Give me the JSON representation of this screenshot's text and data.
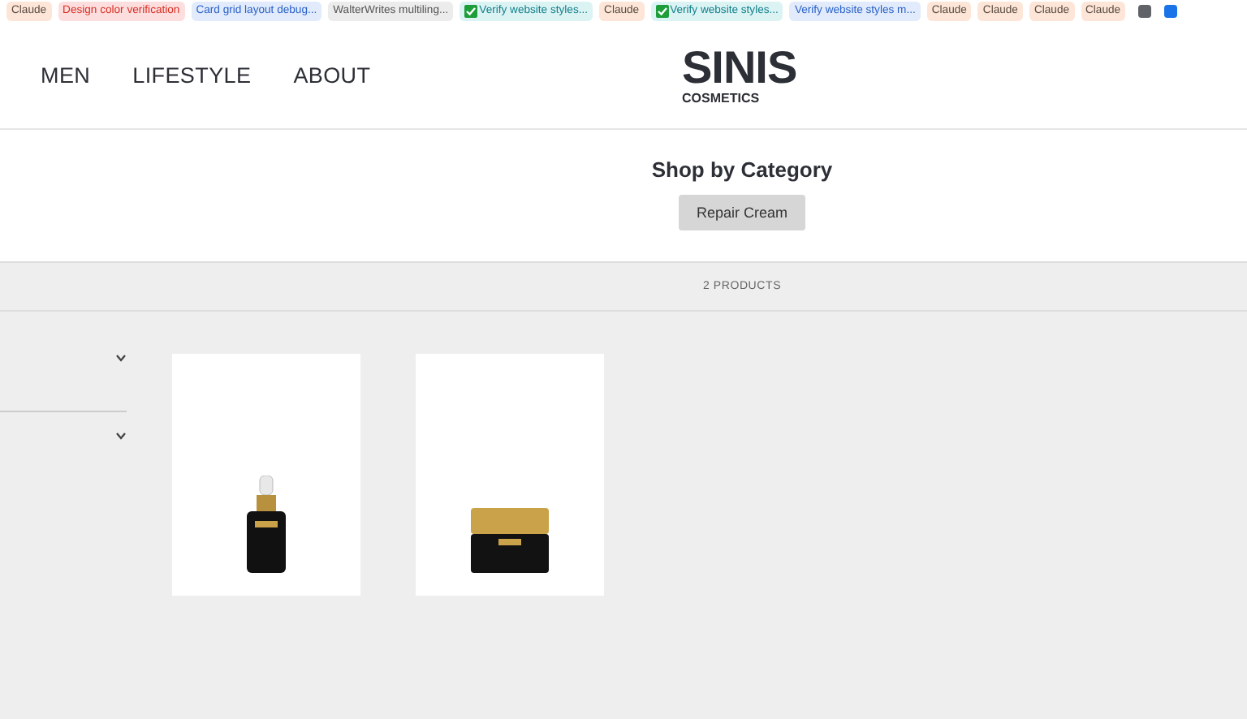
{
  "tab_groups": [
    {
      "kind": "chip",
      "label": "Claude",
      "color": "#fde6d8",
      "done": false
    },
    {
      "kind": "chip",
      "label": "Design color verification",
      "color": "#fddede",
      "done": false
    },
    {
      "kind": "chip",
      "label": "Card grid layout debug...",
      "color": "#e1ebfb",
      "done": false
    },
    {
      "kind": "chip",
      "label": "WalterWrites multiling...",
      "color": "#ececec",
      "done": false
    },
    {
      "kind": "chip",
      "label": "Verify website styles...",
      "color": "#dcf3f4",
      "done": true
    },
    {
      "kind": "chip",
      "label": "Claude",
      "color": "#fde6d8",
      "done": false
    },
    {
      "kind": "chip",
      "label": "Verify website styles...",
      "color": "#dcf3f4",
      "done": true
    },
    {
      "kind": "chip",
      "label": "Verify website styles m...",
      "color": "#e1ebfb",
      "done": false
    },
    {
      "kind": "chip",
      "label": "Claude",
      "color": "#fde6d8",
      "done": false
    },
    {
      "kind": "chip",
      "label": "Claude",
      "color": "#fde6d8",
      "done": false
    },
    {
      "kind": "chip",
      "label": "Claude",
      "color": "#fde6d8",
      "done": false
    },
    {
      "kind": "chip",
      "label": "Claude",
      "color": "#fde6d8",
      "done": false
    },
    {
      "kind": "square",
      "color": "#5f6368"
    },
    {
      "kind": "square",
      "color": "#1a73e8"
    }
  ],
  "nav": [
    {
      "label": "MEN"
    },
    {
      "label": "LIFESTYLE"
    },
    {
      "label": "ABOUT"
    }
  ],
  "logo": {
    "name": "SINIS",
    "tagline": "COSMETICS"
  },
  "category": {
    "title": "Shop by Category",
    "buttons": [
      {
        "label": "Repair Cream"
      }
    ]
  },
  "product_count": "2 PRODUCTS",
  "filters": [
    {
      "expanded": false
    },
    {
      "expanded": false
    }
  ],
  "products": [
    {
      "kind": "bottle"
    },
    {
      "kind": "jar"
    }
  ]
}
